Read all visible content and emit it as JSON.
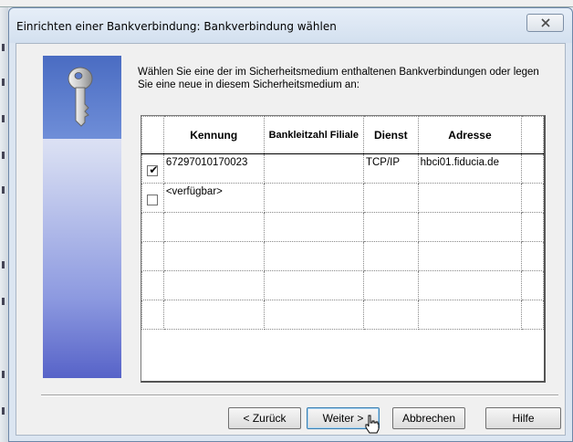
{
  "window": {
    "title": "Einrichten einer Bankverbindung: Bankverbindung wählen",
    "close_icon": "close-icon"
  },
  "instruction": "Wählen Sie eine der im Sicherheitsmedium enthaltenen Bankverbindungen oder legen Sie eine neue in diesem Sicherheitsmedium an:",
  "table": {
    "headers": [
      "Kennung",
      "Bankleitzahl Filiale",
      "Dienst",
      "Adresse"
    ],
    "rows": [
      {
        "checked": true,
        "kennung": "67297010170023",
        "blz": "",
        "dienst": "TCP/IP",
        "adresse": "hbci01.fiducia.de"
      },
      {
        "checked": false,
        "kennung": "<verfügbar>",
        "blz": "",
        "dienst": "",
        "adresse": ""
      }
    ]
  },
  "buttons": {
    "back": "< Zurück",
    "next": "Weiter >",
    "cancel": "Abbrechen",
    "help": "Hilfe"
  },
  "banner_icon": "key-icon"
}
